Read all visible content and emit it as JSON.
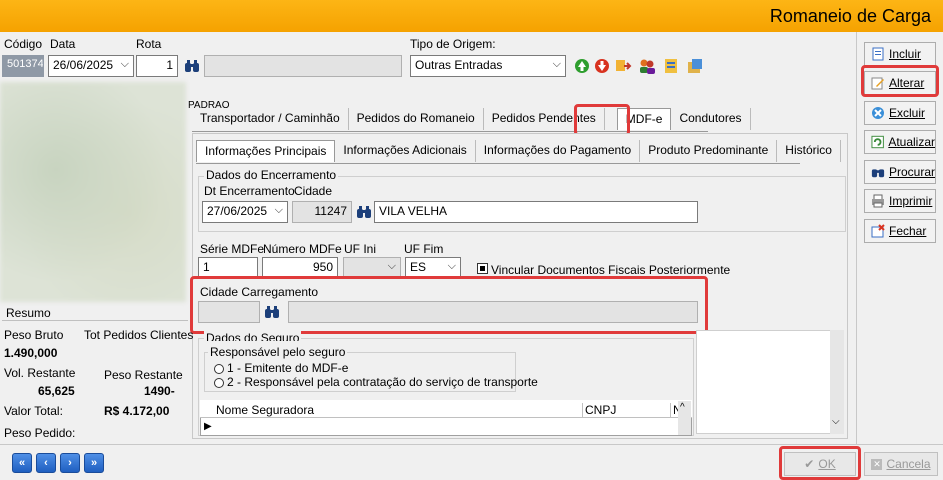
{
  "title": "Romaneio de Carga",
  "header": {
    "codigo_label": "Código",
    "codigo_value": "501374",
    "data_label": "Data",
    "data_value": "26/06/2025",
    "rota_label": "Rota",
    "rota_value": "1",
    "origem_label": "Tipo de Origem:",
    "origem_value": "Outras Entradas",
    "truncated_label": "PADRAO"
  },
  "tabs_main": [
    "Transportador / Caminhão",
    "Pedidos do Romaneio",
    "Pedidos Pendentes",
    "MDF-e",
    "Condutores"
  ],
  "tabs_sub": [
    "Informações Principais",
    "Informações Adicionais",
    "Informações do Pagamento",
    "Produto Predominante",
    "Histórico"
  ],
  "encerramento": {
    "group_label": "Dados do Encerramento",
    "dt_label": "Dt Encerramento",
    "dt_value": "27/06/2025",
    "cidade_label": "Cidade",
    "cidade_code": "11247",
    "cidade_name": "VILA VELHA"
  },
  "mdfe": {
    "serie_label": "Série MDFe",
    "serie_value": "1",
    "numero_label": "Número MDFe",
    "numero_value": "950",
    "ufini_label": "UF Ini",
    "ufini_value": "",
    "uffim_label": "UF Fim",
    "uffim_value": "ES",
    "vincular_label": "Vincular Documentos Fiscais Posteriormente"
  },
  "carregamento": {
    "label": "Cidade Carregamento",
    "code": "",
    "name": ""
  },
  "seguro": {
    "group_label": "Dados do Seguro",
    "resp_label": "Responsável pelo seguro",
    "opt1": "1 - Emitente do MDF-e",
    "opt2": "2 - Responsável pela contratação do serviço de transporte",
    "col_nome": "Nome Seguradora",
    "col_cnpj": "CNPJ",
    "col_n": "N"
  },
  "resumo": {
    "title": "Resumo",
    "peso_bruto_label": "Peso Bruto",
    "tot_pedidos_label": "Tot Pedidos",
    "clientes_label": "Clientes",
    "peso_bruto_value": "1.490,000",
    "vol_restante_label": "Vol. Restante",
    "peso_restante_label": "Peso Restante",
    "vol_restante_value": "65,625",
    "peso_restante_value": "1490-",
    "valor_total_label": "Valor Total:",
    "valor_total_value": "R$ 4.172,00",
    "peso_pedido_label": "Peso Pedido:"
  },
  "sidebar": {
    "incluir": "Incluir",
    "alterar": "Alterar",
    "excluir": "Excluir",
    "atualizar": "Atualizar",
    "procurar": "Procurar",
    "imprimir": "Imprimir",
    "fechar": "Fechar"
  },
  "footer": {
    "ok": "OK",
    "cancela": "Cancela"
  },
  "colors": {
    "accent": "#f5a200",
    "highlight": "#e03a3a",
    "nav": "#1f5fc0"
  }
}
